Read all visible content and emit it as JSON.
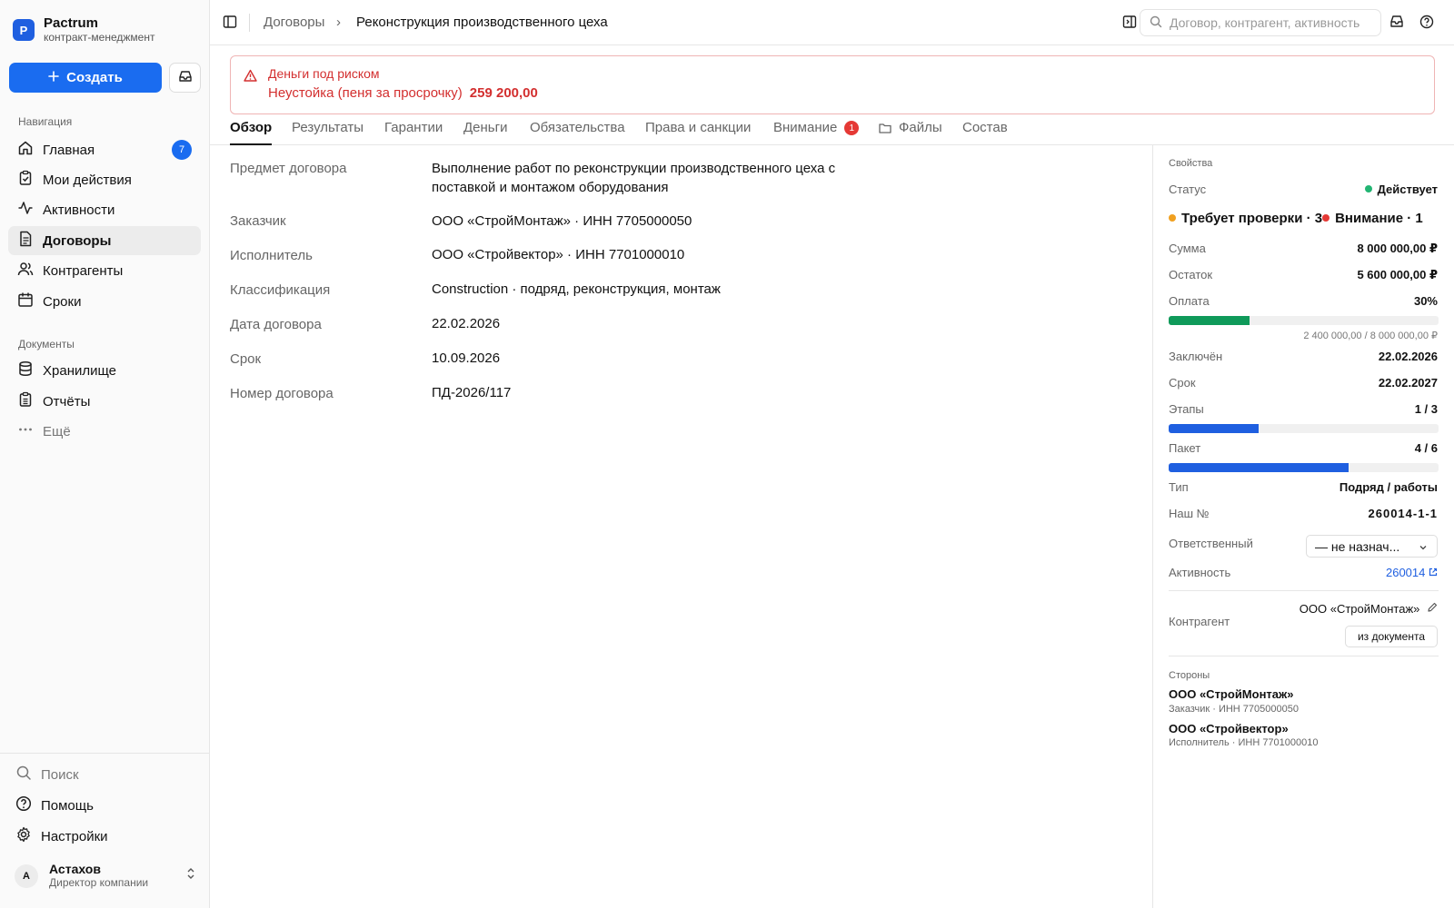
{
  "brand": {
    "logo_letter": "P",
    "name": "Pactrum",
    "subtitle": "контракт-менеджмент"
  },
  "sidebar": {
    "create_label": "Создать",
    "nav_title": "Навигация",
    "nav_items": [
      {
        "label": "Главная",
        "icon": "home-icon",
        "badge": "7"
      },
      {
        "label": "Мои действия",
        "icon": "clipboard-check-icon"
      },
      {
        "label": "Активности",
        "icon": "activity-icon"
      },
      {
        "label": "Договоры",
        "icon": "document-icon",
        "active": true
      },
      {
        "label": "Контрагенты",
        "icon": "users-icon"
      },
      {
        "label": "Сроки",
        "icon": "calendar-icon"
      }
    ],
    "docs_title": "Документы",
    "doc_items": [
      {
        "label": "Хранилище",
        "icon": "database-icon"
      },
      {
        "label": "Отчёты",
        "icon": "clipboard-list-icon"
      },
      {
        "label": "Ещё",
        "icon": "more-icon"
      }
    ],
    "bottom_items": [
      {
        "label": "Поиск",
        "icon": "search-icon"
      },
      {
        "label": "Помощь",
        "icon": "help-icon"
      },
      {
        "label": "Настройки",
        "icon": "gear-icon"
      }
    ],
    "user": {
      "initial": "А",
      "name": "Астахов",
      "role": "Директор компании"
    }
  },
  "topbar": {
    "breadcrumb": [
      "Договоры",
      "Реконструкция производственного цеха"
    ],
    "breadcrumb_separator": "›",
    "search_placeholder": "Договор, контрагент, активность"
  },
  "alert": {
    "title": "Деньги под риском",
    "text": "Неустойка (пеня за просрочку)",
    "amount": "259 200,00",
    "color": "#d32f2f"
  },
  "tabs": [
    {
      "label": "Обзор",
      "active": true
    },
    {
      "label": "Результаты"
    },
    {
      "label": "Гарантии"
    },
    {
      "label": "Деньги"
    },
    {
      "label": "Обязательства"
    },
    {
      "label": "Права и санкции"
    },
    {
      "label": "Внимание",
      "badge": "1"
    },
    {
      "label": "Файлы",
      "icon": "folder-icon"
    },
    {
      "label": "Состав"
    }
  ],
  "overview": [
    {
      "label": "Предмет договора",
      "value": "Выполнение работ по реконструкции производственного цеха с поставкой и монтажом оборудования"
    },
    {
      "label": "Заказчик",
      "value": "ООО «СтройМонтаж» · ИНН 7705000050"
    },
    {
      "label": "Исполнитель",
      "value": "ООО «Стройвектор» · ИНН 7701000010"
    },
    {
      "label": "Классификация",
      "value": "Construction · подряд, реконструкция, монтаж"
    },
    {
      "label": "Дата договора",
      "value": "22.02.2026"
    },
    {
      "label": "Срок",
      "value": "10.09.2026"
    },
    {
      "label": "Номер договора",
      "value": "ПД-2026/117"
    }
  ],
  "properties": {
    "title": "Свойства",
    "status": {
      "label": "Статус",
      "value": "Действует",
      "color": "#22b573"
    },
    "flags": [
      {
        "text": "Требует проверки · 3",
        "color": "#f0a020"
      },
      {
        "text": "Внимание · 1",
        "color": "#e53935"
      }
    ],
    "sum": {
      "label": "Сумма",
      "value": "8 000 000,00 ₽"
    },
    "remainder": {
      "label": "Остаток",
      "value": "5 600 000,00 ₽"
    },
    "payment": {
      "label": "Оплата",
      "value": "30%",
      "fraction": 0.3,
      "detail": "2 400 000,00 / 8 000 000,00 ₽",
      "color": "#0f9a5a"
    },
    "concluded": {
      "label": "Заключён",
      "value": "22.02.2026"
    },
    "term": {
      "label": "Срок",
      "value": "22.02.2027"
    },
    "stages": {
      "label": "Этапы",
      "value": "1 / 3",
      "fraction": 0.333,
      "color": "#1f5fe0"
    },
    "package": {
      "label": "Пакет",
      "value": "4 / 6",
      "fraction": 0.667,
      "color": "#1f5fe0"
    },
    "type": {
      "label": "Тип",
      "value": "Подряд / работы"
    },
    "our_no": {
      "label": "Наш №",
      "value": "260014-1-1"
    },
    "responsible": {
      "label": "Ответственный",
      "value": "— не назнач..."
    },
    "activity": {
      "label": "Активность",
      "value": "260014"
    },
    "counterparty": {
      "label": "Контрагент",
      "value": "ООО «СтройМонтаж»",
      "button": "из документа"
    },
    "parties_title": "Стороны",
    "parties": [
      {
        "name": "ООО «СтройМонтаж»",
        "sub": "Заказчик · ИНН 7705000050"
      },
      {
        "name": "ООО «Стройвектор»",
        "sub": "Исполнитель · ИНН 7701000010"
      }
    ]
  }
}
